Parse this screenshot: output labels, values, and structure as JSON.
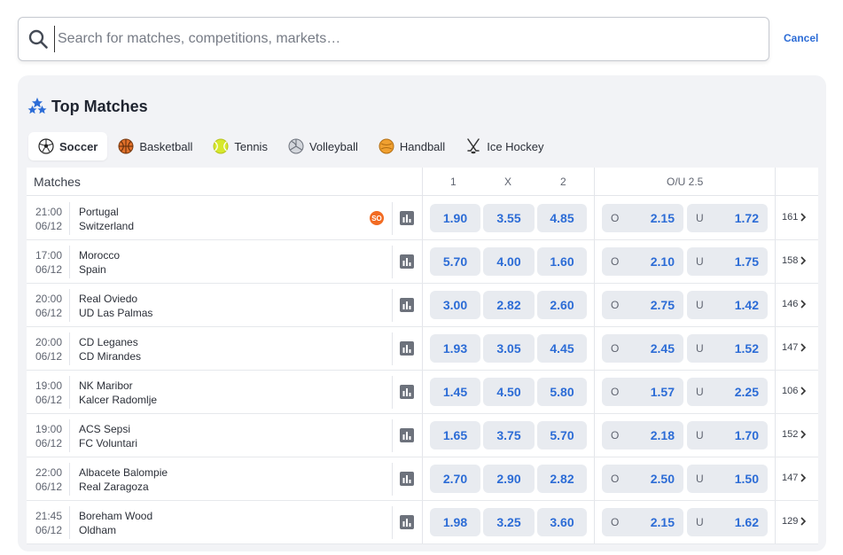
{
  "search": {
    "placeholder": "Search for matches, competitions, markets…",
    "cancel_label": "Cancel"
  },
  "section": {
    "title": "Top Matches",
    "tabs": [
      {
        "label": "Soccer",
        "icon": "soccer-ball-icon",
        "active": true
      },
      {
        "label": "Basketball",
        "icon": "basketball-icon",
        "active": false
      },
      {
        "label": "Tennis",
        "icon": "tennis-ball-icon",
        "active": false
      },
      {
        "label": "Volleyball",
        "icon": "volleyball-icon",
        "active": false
      },
      {
        "label": "Handball",
        "icon": "handball-icon",
        "active": false
      },
      {
        "label": "Ice Hockey",
        "icon": "ice-hockey-icon",
        "active": false
      }
    ]
  },
  "table": {
    "headers": {
      "matches": "Matches",
      "home": "1",
      "draw": "X",
      "away": "2",
      "ou": "O/U 2.5"
    },
    "over_label": "O",
    "under_label": "U",
    "rows": [
      {
        "time": "21:00",
        "date": "06/12",
        "home": "Portugal",
        "away": "Switzerland",
        "badge": "SO",
        "o1": "1.90",
        "ox": "3.55",
        "o2": "4.85",
        "over": "2.15",
        "under": "1.72",
        "markets": "161"
      },
      {
        "time": "17:00",
        "date": "06/12",
        "home": "Morocco",
        "away": "Spain",
        "badge": "",
        "o1": "5.70",
        "ox": "4.00",
        "o2": "1.60",
        "over": "2.10",
        "under": "1.75",
        "markets": "158"
      },
      {
        "time": "20:00",
        "date": "06/12",
        "home": "Real Oviedo",
        "away": "UD Las Palmas",
        "badge": "",
        "o1": "3.00",
        "ox": "2.82",
        "o2": "2.60",
        "over": "2.75",
        "under": "1.42",
        "markets": "146"
      },
      {
        "time": "20:00",
        "date": "06/12",
        "home": "CD Leganes",
        "away": "CD Mirandes",
        "badge": "",
        "o1": "1.93",
        "ox": "3.05",
        "o2": "4.45",
        "over": "2.45",
        "under": "1.52",
        "markets": "147"
      },
      {
        "time": "19:00",
        "date": "06/12",
        "home": "NK Maribor",
        "away": "Kalcer Radomlje",
        "badge": "",
        "o1": "1.45",
        "ox": "4.50",
        "o2": "5.80",
        "over": "1.57",
        "under": "2.25",
        "markets": "106"
      },
      {
        "time": "19:00",
        "date": "06/12",
        "home": "ACS Sepsi",
        "away": "FC Voluntari",
        "badge": "",
        "o1": "1.65",
        "ox": "3.75",
        "o2": "5.70",
        "over": "2.18",
        "under": "1.70",
        "markets": "152"
      },
      {
        "time": "22:00",
        "date": "06/12",
        "home": "Albacete Balompie",
        "away": "Real Zaragoza",
        "badge": "",
        "o1": "2.70",
        "ox": "2.90",
        "o2": "2.82",
        "over": "2.50",
        "under": "1.50",
        "markets": "147"
      },
      {
        "time": "21:45",
        "date": "06/12",
        "home": "Boreham Wood",
        "away": "Oldham",
        "badge": "",
        "o1": "1.98",
        "ox": "3.25",
        "o2": "3.60",
        "over": "2.15",
        "under": "1.62",
        "markets": "129"
      }
    ]
  },
  "colors": {
    "accent": "#2c6cd6",
    "odds_bg": "#e8ebf0",
    "badge": "#f26b22",
    "panel_bg": "#f2f3f6"
  }
}
